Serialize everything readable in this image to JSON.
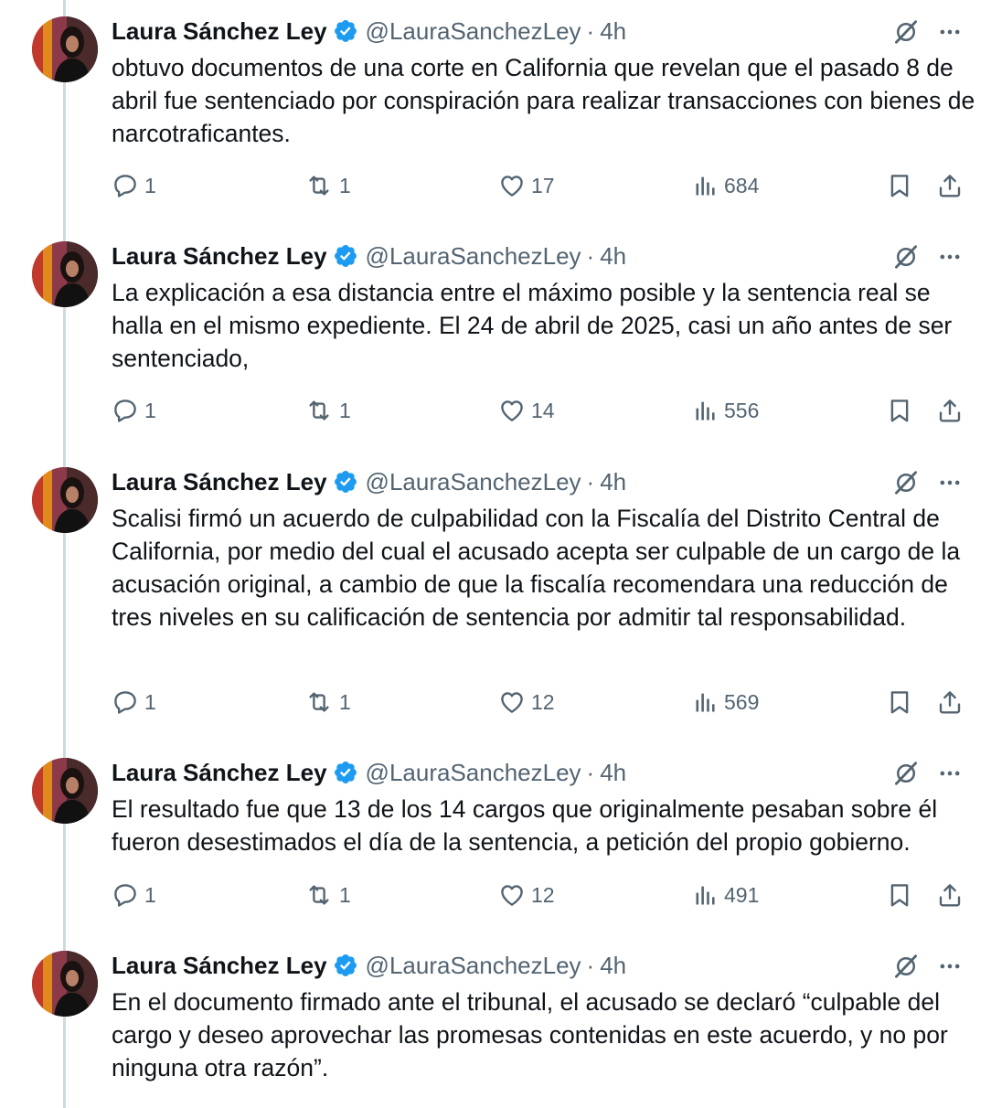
{
  "tweets": [
    {
      "name": "Laura Sánchez Ley",
      "handle": "@LauraSanchezLey",
      "time": "4h",
      "text": "obtuvo documentos de una corte en California que revelan que el pasado 8 de abril fue sentenciado por conspiración para realizar transacciones con bienes de narcotraficantes.",
      "replies": "1",
      "retweets": "1",
      "likes": "17",
      "views": "684"
    },
    {
      "name": "Laura Sánchez Ley",
      "handle": "@LauraSanchezLey",
      "time": "4h",
      "text": "La explicación a esa distancia entre el máximo posible y la sentencia real se halla en el mismo expediente. El 24 de abril de 2025, casi un año antes de ser sentenciado,",
      "replies": "1",
      "retweets": "1",
      "likes": "14",
      "views": "556"
    },
    {
      "name": "Laura Sánchez Ley",
      "handle": "@LauraSanchezLey",
      "time": "4h",
      "text": "Scalisi firmó un acuerdo de culpabilidad con la Fiscalía del Distrito Central de California, por medio del cual el acusado acepta ser culpable de un cargo de la acusación original, a cambio de que la fiscalía recomendara una reducción de tres niveles en su calificación de sentencia por admitir tal responsabilidad.",
      "replies": "1",
      "retweets": "1",
      "likes": "12",
      "views": "569"
    },
    {
      "name": "Laura Sánchez Ley",
      "handle": "@LauraSanchezLey",
      "time": "4h",
      "text": "El resultado fue que 13 de los 14 cargos que originalmente pesaban sobre él fueron desestimados el día de la sentencia, a petición del propio gobierno.",
      "replies": "1",
      "retweets": "1",
      "likes": "12",
      "views": "491"
    },
    {
      "name": "Laura Sánchez Ley",
      "handle": "@LauraSanchezLey",
      "time": "4h",
      "text": "En el documento firmado ante el tribunal, el acusado se declaró “culpable del cargo y deseo aprovechar las promesas contenidas en este acuerdo, y no por ninguna otra razón”."
    }
  ],
  "colors": {
    "text": "#0f1419",
    "secondary": "#536471",
    "verified": "#1d9bf0",
    "thread_line": "#cfd9de"
  },
  "icons": [
    "verified-badge-icon",
    "grok-icon",
    "more-icon",
    "reply-icon",
    "retweet-icon",
    "like-icon",
    "views-icon",
    "bookmark-icon",
    "share-icon"
  ]
}
